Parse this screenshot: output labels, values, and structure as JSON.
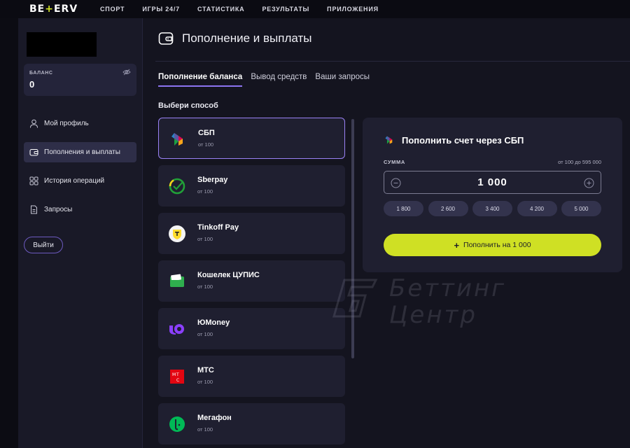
{
  "brand": {
    "logo_left": "BE",
    "logo_plus": "+",
    "logo_right": "ERV",
    "accent": "#d2e425",
    "purple": "#8c74f0"
  },
  "nav": [
    "СПОРТ",
    "ИГРЫ 24/7",
    "СТАТИСТИКА",
    "РЕЗУЛЬТАТЫ",
    "ПРИЛОЖЕНИЯ"
  ],
  "sidebar": {
    "balance_label": "БАЛАНС",
    "balance_value": "0",
    "items": [
      {
        "label": "Мой профиль",
        "icon": "user-icon",
        "active": false
      },
      {
        "label": "Пополнения и выплаты",
        "icon": "wallet-icon",
        "active": true
      },
      {
        "label": "История операций",
        "icon": "grid-icon",
        "active": false
      },
      {
        "label": "Запросы",
        "icon": "document-icon",
        "active": false
      }
    ],
    "logout_label": "Выйти"
  },
  "main": {
    "title": "Пополнение и выплаты",
    "tabs": [
      {
        "label": "Пополнение баланса",
        "active": true
      },
      {
        "label": "Вывод средств",
        "active": false
      },
      {
        "label": "Ваши запросы",
        "active": false
      }
    ],
    "choose_label": "Выбери способ",
    "methods": [
      {
        "name": "СБП",
        "min": "от 100",
        "icon": "sbp-icon",
        "selected": true
      },
      {
        "name": "Sberpay",
        "min": "от 100",
        "icon": "sberpay-icon",
        "selected": false
      },
      {
        "name": "Tinkoff Pay",
        "min": "от 100",
        "icon": "tinkoff-icon",
        "selected": false
      },
      {
        "name": "Кошелек ЦУПИС",
        "min": "от 100",
        "icon": "cupis-wallet-icon",
        "selected": false
      },
      {
        "name": "ЮMoney",
        "min": "от 100",
        "icon": "yumoney-icon",
        "selected": false
      },
      {
        "name": "МТС",
        "min": "от 100",
        "icon": "mts-icon",
        "selected": false
      },
      {
        "name": "Мегафон",
        "min": "от 100",
        "icon": "megafon-icon",
        "selected": false
      }
    ]
  },
  "payment": {
    "title": "Пополнить счет через СБП",
    "amount_label": "СУММА",
    "amount_range": "от 100 до 595 000",
    "amount_value": "1 000",
    "quick_amounts": [
      "1 800",
      "2 600",
      "3 400",
      "4 200",
      "5 000"
    ],
    "submit_plus": "+",
    "submit_label": "Пополнить на 1 000"
  },
  "watermark": {
    "line1": "Беттинг",
    "line2": "Центр"
  }
}
